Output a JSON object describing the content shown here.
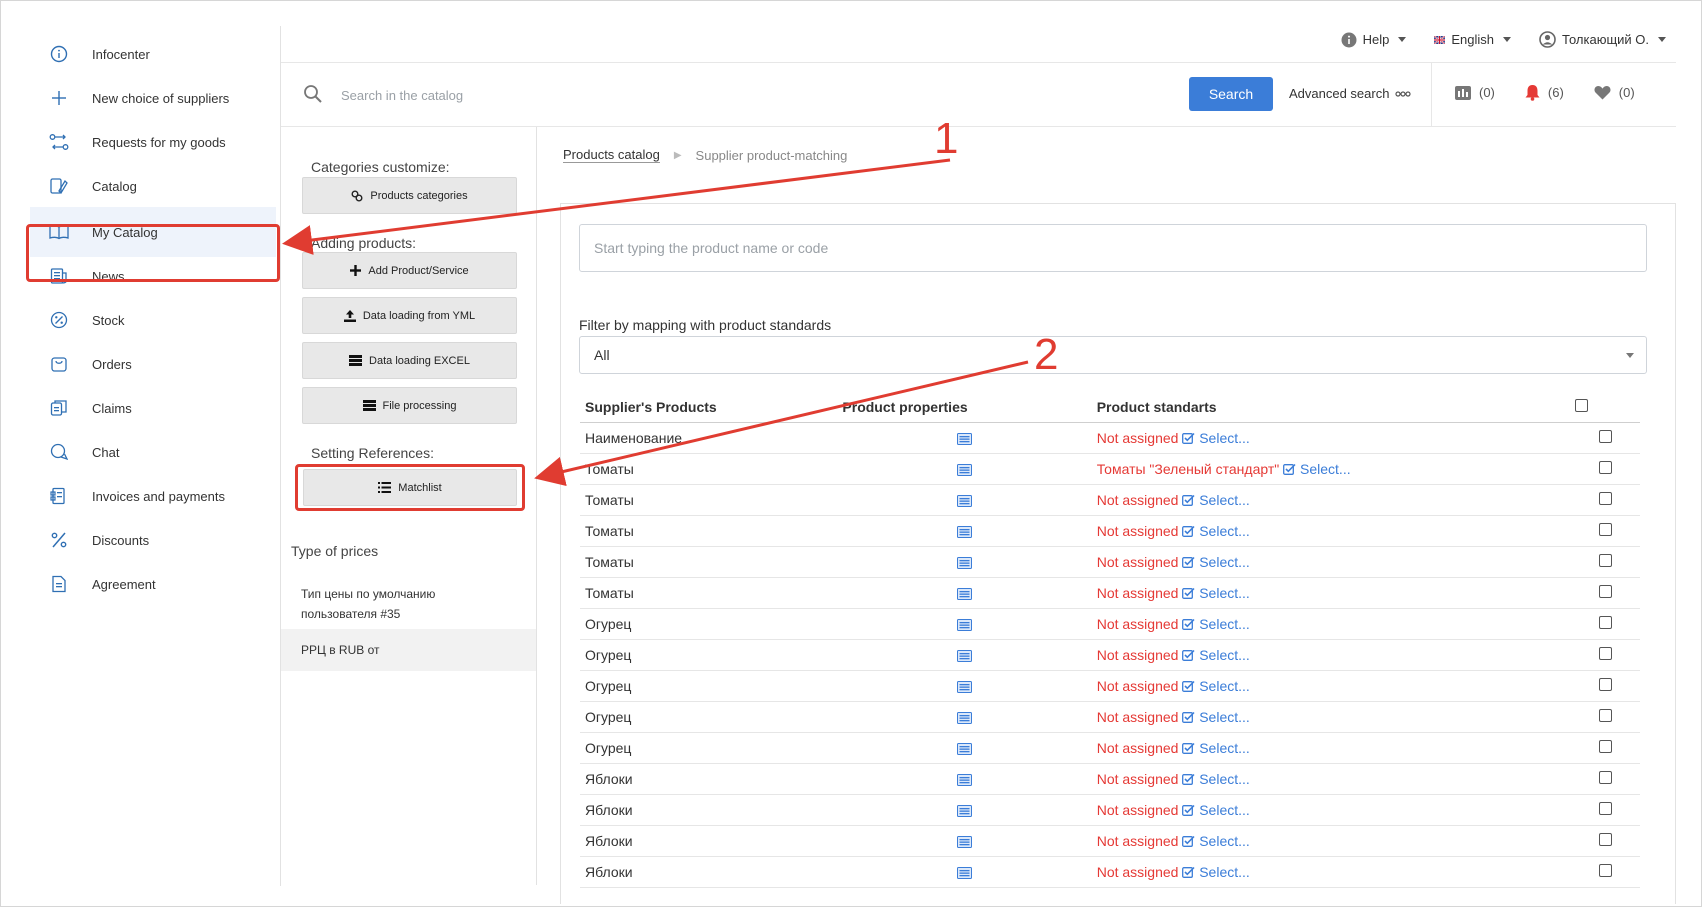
{
  "sidebar": {
    "items": [
      {
        "label": "Infocenter",
        "icon": "info-icon"
      },
      {
        "label": "New choice of suppliers",
        "icon": "plus-icon"
      },
      {
        "label": "Requests for my goods",
        "icon": "route-icon"
      },
      {
        "label": "Catalog",
        "icon": "catalog-icon"
      },
      {
        "label": "My Catalog",
        "icon": "book-icon",
        "active": true
      },
      {
        "label": "News",
        "icon": "news-icon"
      },
      {
        "label": "Stock",
        "icon": "percent-badge-icon"
      },
      {
        "label": "Orders",
        "icon": "bag-icon"
      },
      {
        "label": "Claims",
        "icon": "claims-icon"
      },
      {
        "label": "Chat",
        "icon": "chat-icon"
      },
      {
        "label": "Invoices and payments",
        "icon": "invoice-icon"
      },
      {
        "label": "Discounts",
        "icon": "percent-icon"
      },
      {
        "label": "Agreement",
        "icon": "document-icon"
      }
    ]
  },
  "topbar": {
    "help": "Help",
    "language": "English",
    "user": "Толкающий О."
  },
  "search": {
    "placeholder": "Search in the catalog",
    "button": "Search",
    "advanced": "Advanced search"
  },
  "counters": {
    "compare": "(0)",
    "notifications": "(6)",
    "favorites": "(0)"
  },
  "midpanel": {
    "categories_label": "Categories customize:",
    "products_categories": "Products categories",
    "adding_label": "Adding products:",
    "add_product": "Add Product/Service",
    "yml": "Data loading from YML",
    "excel": "Data loading EXCEL",
    "file_processing": "File processing",
    "references_label": "Setting References:",
    "matchlist": "Matchlist",
    "price_types_title": "Type of prices",
    "price_types": [
      {
        "line1": "Тип цены по умолчанию",
        "line2": "пользователя #35"
      },
      {
        "line1": "РРЦ в RUB от",
        "line2": ""
      }
    ]
  },
  "breadcrumb": {
    "root": "Products catalog",
    "current": "Supplier product-matching"
  },
  "main": {
    "product_input_placeholder": "Start typing the product name or code",
    "filter_label": "Filter by mapping with product standards",
    "filter_value": "All",
    "columns": {
      "products": "Supplier's Products",
      "properties": "Product properties",
      "standards": "Product standarts"
    },
    "select_label": "Select...",
    "rows": [
      {
        "name": "Наименование",
        "status": "Not assigned"
      },
      {
        "name": "Томаты",
        "status": "Томаты \"Зеленый стандарт\""
      },
      {
        "name": "Томаты",
        "status": "Not assigned"
      },
      {
        "name": "Томаты",
        "status": "Not assigned"
      },
      {
        "name": "Томаты",
        "status": "Not assigned"
      },
      {
        "name": "Томаты",
        "status": "Not assigned"
      },
      {
        "name": "Огурец",
        "status": "Not assigned"
      },
      {
        "name": "Огурец",
        "status": "Not assigned"
      },
      {
        "name": "Огурец",
        "status": "Not assigned"
      },
      {
        "name": "Огурец",
        "status": "Not assigned"
      },
      {
        "name": "Огурец",
        "status": "Not assigned"
      },
      {
        "name": "Яблоки",
        "status": "Not assigned"
      },
      {
        "name": "Яблоки",
        "status": "Not assigned"
      },
      {
        "name": "Яблоки",
        "status": "Not assigned"
      },
      {
        "name": "Яблоки",
        "status": "Not assigned"
      }
    ]
  },
  "annotations": {
    "one": "1",
    "two": "2"
  },
  "colors": {
    "accent": "#3b7dd8",
    "annotation": "#e03c31",
    "not_assigned": "#e53935"
  }
}
